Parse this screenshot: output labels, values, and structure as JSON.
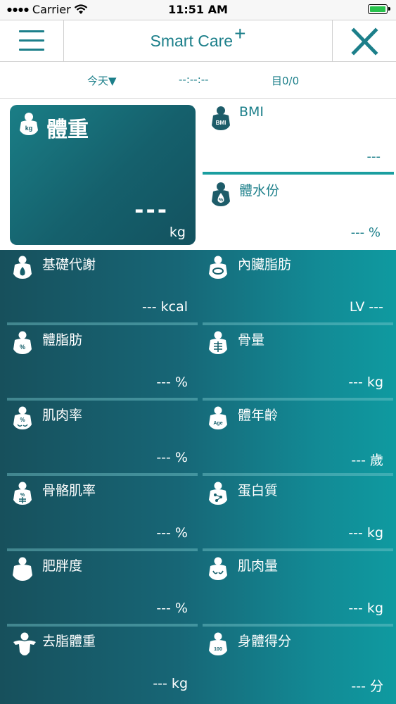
{
  "status_bar": {
    "carrier": "Carrier",
    "time": "11:51 AM"
  },
  "nav": {
    "title": "Smart Care",
    "title_plus": "+"
  },
  "date_row": {
    "today": "今天▼",
    "time": "--:--:--",
    "record": "目0/0"
  },
  "weight": {
    "label": "體重",
    "value": "---",
    "unit": "kg",
    "icon_text": "kg"
  },
  "bmi": {
    "label": "BMI",
    "value": "---",
    "icon_text": "BMI"
  },
  "water": {
    "label": "體水份",
    "value": "--- %",
    "icon_text": "%"
  },
  "metrics": [
    {
      "label": "基礎代謝",
      "value": "--- kcal",
      "icon": "metabolism-icon",
      "icon_text": ""
    },
    {
      "label": "內臟脂肪",
      "value": "LV ---",
      "icon": "visceral-fat-icon",
      "icon_text": ""
    },
    {
      "label": "體脂肪",
      "value": "--- %",
      "icon": "body-fat-icon",
      "icon_text": "%"
    },
    {
      "label": "骨量",
      "value": "--- kg",
      "icon": "bone-mass-icon",
      "icon_text": ""
    },
    {
      "label": "肌肉率",
      "value": "--- %",
      "icon": "muscle-rate-icon",
      "icon_text": "%"
    },
    {
      "label": "體年齡",
      "value": "--- 歲",
      "icon": "body-age-icon",
      "icon_text": "Age"
    },
    {
      "label": "骨骼肌率",
      "value": "--- %",
      "icon": "skeletal-muscle-icon",
      "icon_text": "%"
    },
    {
      "label": "蛋白質",
      "value": "--- kg",
      "icon": "protein-icon",
      "icon_text": ""
    },
    {
      "label": "肥胖度",
      "value": "--- %",
      "icon": "obesity-icon",
      "icon_text": ""
    },
    {
      "label": "肌肉量",
      "value": "--- kg",
      "icon": "muscle-mass-icon",
      "icon_text": ""
    },
    {
      "label": "去脂體重",
      "value": "--- kg",
      "icon": "lean-mass-icon",
      "icon_text": ""
    },
    {
      "label": "身體得分",
      "value": "--- 分",
      "icon": "body-score-icon",
      "icon_text": "100"
    }
  ],
  "colors": {
    "teal": "#1c7f8a",
    "accent": "#1a9ea0",
    "battery": "#27c24c"
  }
}
